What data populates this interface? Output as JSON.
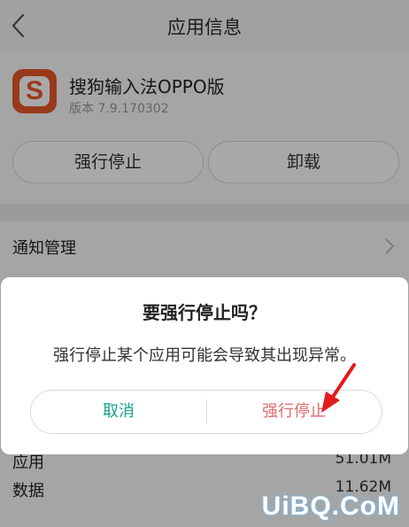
{
  "header": {
    "title": "应用信息",
    "back_icon": "chevron-left-icon"
  },
  "app": {
    "name": "搜狗输入法OPPO版",
    "version": "版本 7.9.170302",
    "icon": "sogou-s-icon",
    "icon_letter": "S",
    "icon_color": "#e9572a"
  },
  "actions": {
    "force_stop": "强行停止",
    "uninstall": "卸载"
  },
  "settings": {
    "notify_label": "通知管理",
    "storage": [
      {
        "label": "应用",
        "value": "51.01M"
      },
      {
        "label": "数据",
        "value": "11.62M"
      }
    ]
  },
  "dialog": {
    "title": "要强行停止吗？",
    "message": "强行停止某个应用可能会导致其出现异常。",
    "cancel": "取消",
    "confirm": "强行停止",
    "cancel_color": "#15a08a",
    "confirm_color": "#e06c6c"
  },
  "annotation": {
    "arrow_color": "#e21b1b"
  },
  "watermark": "UiBQ.CoM"
}
